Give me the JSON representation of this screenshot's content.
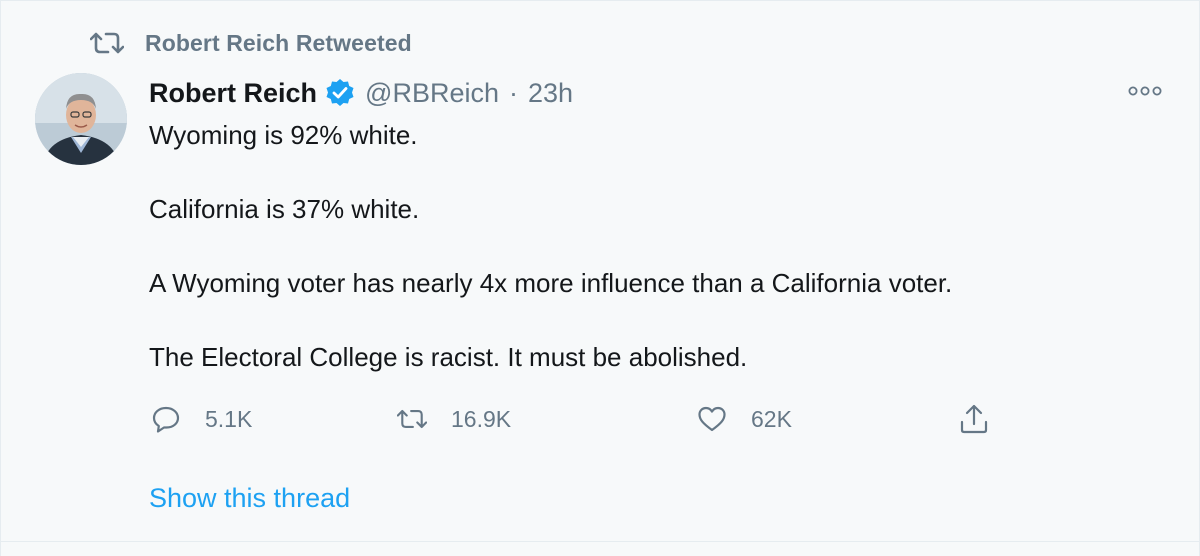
{
  "retweet": {
    "icon": "retweet-icon",
    "label": "Robert Reich Retweeted"
  },
  "author": {
    "name": "Robert Reich",
    "verified_icon": "verified-badge-icon",
    "handle": "@RBReich",
    "separator": "·",
    "time": "23h"
  },
  "more_icon": "more-options-icon",
  "tweet": {
    "lines": [
      "Wyoming is 92% white.",
      "California is 37% white.",
      "A Wyoming voter has nearly 4x more influence than a California voter.",
      "The Electoral College is racist. It must be abolished."
    ]
  },
  "actions": {
    "reply": {
      "icon": "reply-icon",
      "count": "5.1K"
    },
    "retweet": {
      "icon": "retweet-icon",
      "count": "16.9K"
    },
    "like": {
      "icon": "heart-icon",
      "count": "62K"
    },
    "share": {
      "icon": "share-icon"
    }
  },
  "show_thread": "Show this thread",
  "colors": {
    "background": "#f7f9fa",
    "text_primary": "#14171a",
    "text_secondary": "#657786",
    "link": "#1da1f2",
    "verified": "#1da1f2"
  }
}
